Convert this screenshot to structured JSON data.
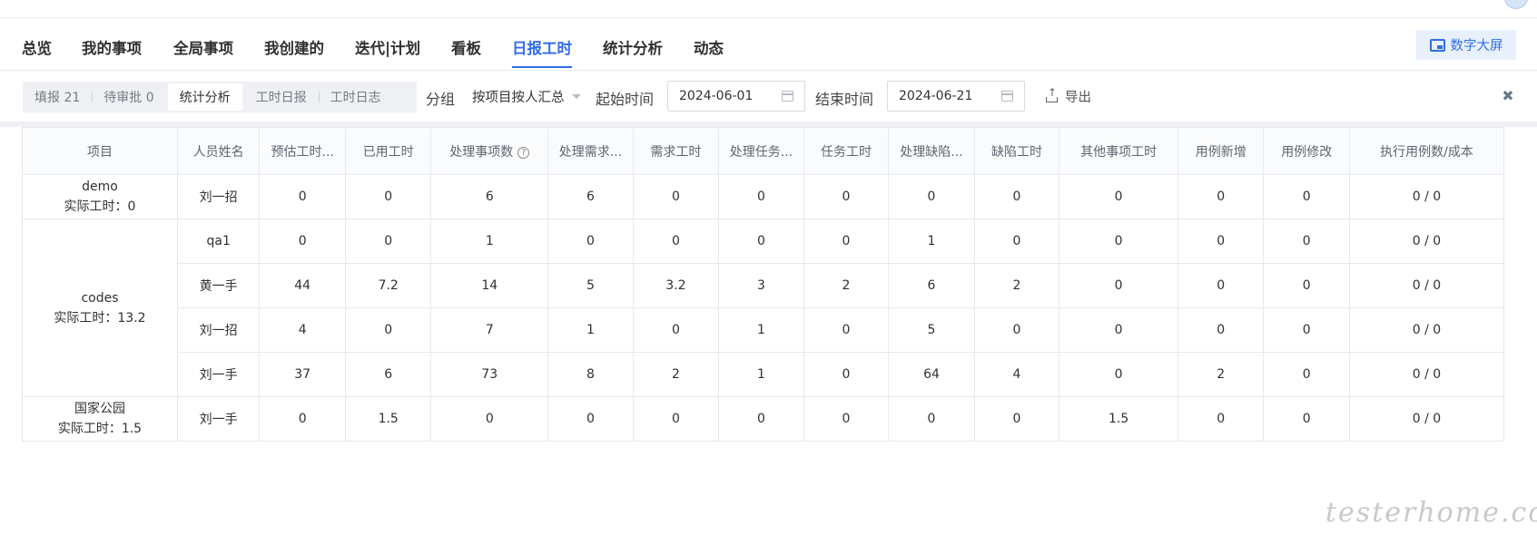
{
  "nav": {
    "tabs": [
      "总览",
      "我的事项",
      "全局事项",
      "我创建的",
      "迭代|计划",
      "看板",
      "日报工时",
      "统计分析",
      "动态"
    ],
    "active_index": 6,
    "big_screen_label": "数字大屏"
  },
  "toolbar": {
    "segments": [
      "填报 21",
      "待审批 0",
      "统计分析",
      "工时日报",
      "工时日志"
    ],
    "active_segment": 2,
    "group_label": "分组",
    "group_value": "按项目按人汇总",
    "start_label": "起始时间",
    "start_value": "2024-06-01",
    "end_label": "结束时间",
    "end_value": "2024-06-21",
    "export_label": "导出"
  },
  "table": {
    "headers": [
      "项目",
      "人员姓名",
      "预估工时...",
      "已用工时",
      "处理事项数",
      "处理需求...",
      "需求工时",
      "处理任务...",
      "任务工时",
      "处理缺陷...",
      "缺陷工时",
      "其他事项工时",
      "用例新增",
      "用例修改",
      "执行用例数/成本"
    ],
    "groups": [
      {
        "project": "demo",
        "actual": "实际工时：0",
        "rows": [
          [
            "刘一招",
            "0",
            "0",
            "6",
            "6",
            "0",
            "0",
            "0",
            "0",
            "0",
            "0",
            "0",
            "0",
            "0 / 0"
          ]
        ]
      },
      {
        "project": "codes",
        "actual": "实际工时：13.2",
        "rows": [
          [
            "qa1",
            "0",
            "0",
            "1",
            "0",
            "0",
            "0",
            "0",
            "1",
            "0",
            "0",
            "0",
            "0",
            "0 / 0"
          ],
          [
            "黄一手",
            "44",
            "7.2",
            "14",
            "5",
            "3.2",
            "3",
            "2",
            "6",
            "2",
            "0",
            "0",
            "0",
            "0 / 0"
          ],
          [
            "刘一招",
            "4",
            "0",
            "7",
            "1",
            "0",
            "1",
            "0",
            "5",
            "0",
            "0",
            "0",
            "0",
            "0 / 0"
          ],
          [
            "刘一手",
            "37",
            "6",
            "73",
            "8",
            "2",
            "1",
            "0",
            "64",
            "4",
            "0",
            "2",
            "0",
            "0 / 0"
          ]
        ]
      },
      {
        "project": "国家公园",
        "actual": "实际工时：1.5",
        "rows": [
          [
            "刘一手",
            "0",
            "1.5",
            "0",
            "0",
            "0",
            "0",
            "0",
            "0",
            "0",
            "1.5",
            "0",
            "0",
            "0 / 0"
          ]
        ]
      }
    ]
  },
  "watermark": "testerhome.com",
  "colors": {
    "accent": "#2f6de5",
    "accent_bg": "#e8f0fc",
    "border": "#e7e9ed",
    "segment_bg": "#eef0f4"
  }
}
